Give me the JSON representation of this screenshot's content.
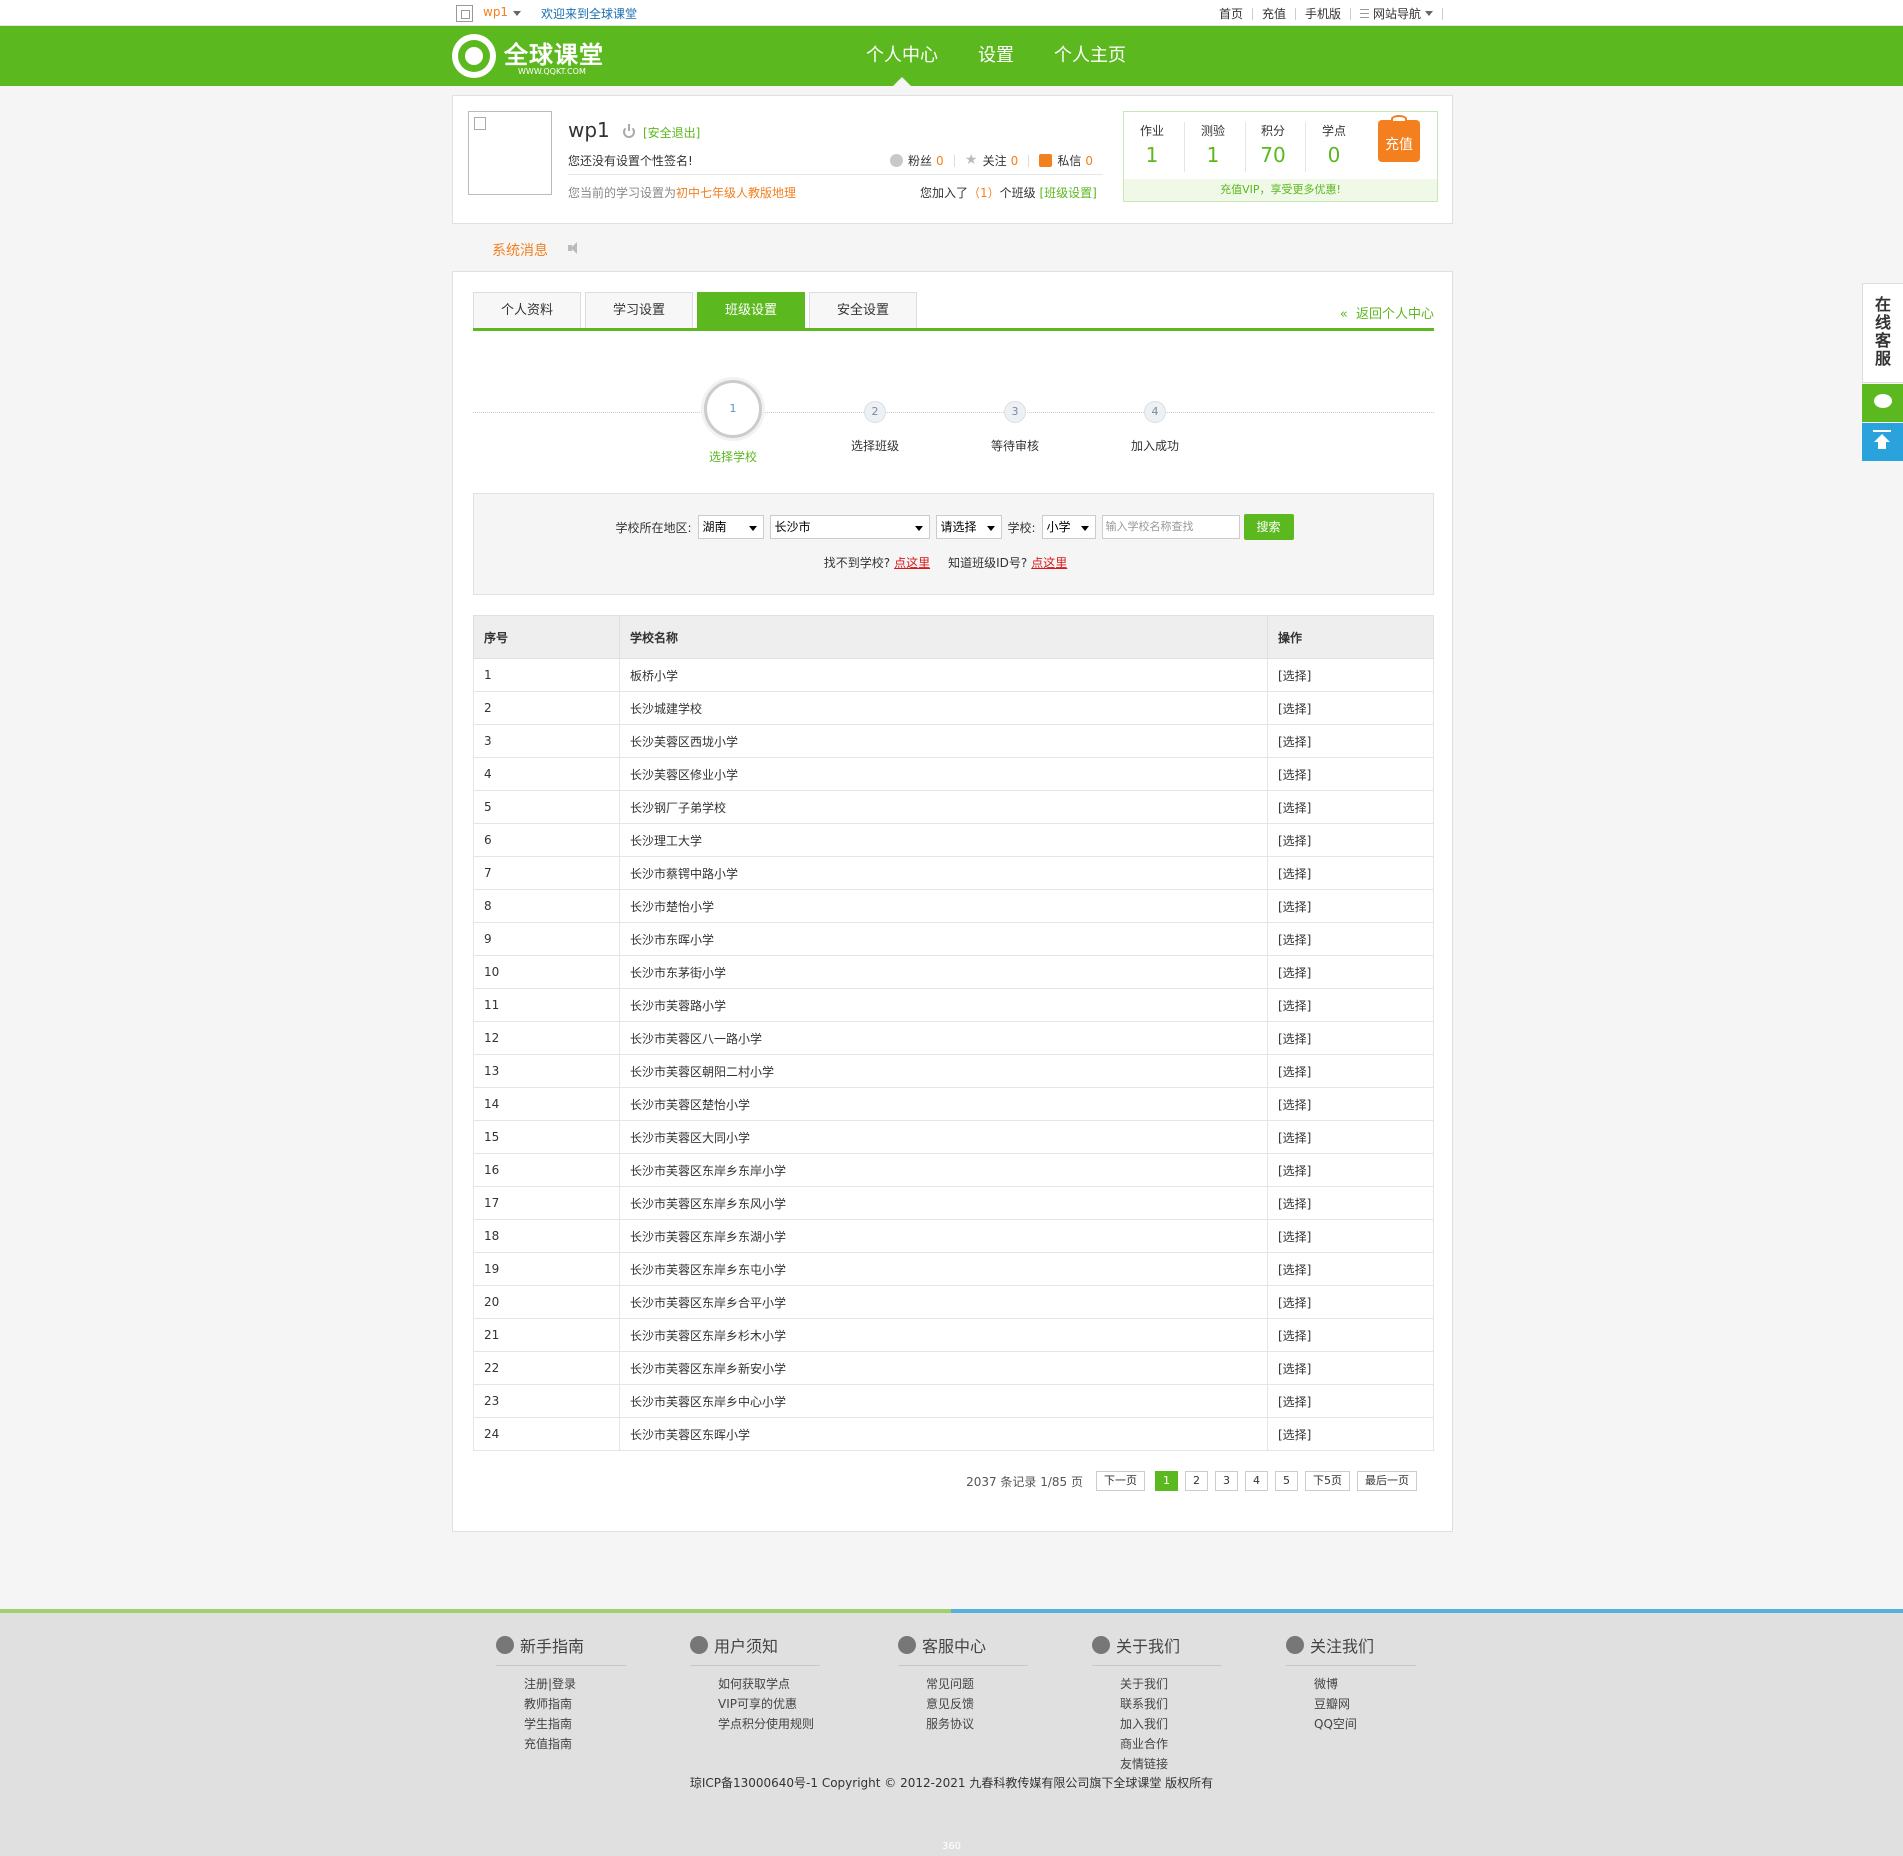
{
  "topbar": {
    "user": "wp1",
    "welcome": "欢迎来到全球课堂",
    "links": [
      "首页",
      "充值",
      "手机版",
      "网站导航"
    ]
  },
  "header": {
    "logo_text": "全球课堂",
    "logo_sub": "WWW.QQKT.COM",
    "nav": [
      "个人中心",
      "设置",
      "个人主页"
    ]
  },
  "profile": {
    "name": "wp1",
    "logout": "[安全退出]",
    "signature": "您还没有设置个性签名!",
    "fans_label": "粉丝",
    "fans": "0",
    "follow_label": "关注",
    "follow": "0",
    "msg_label": "私信",
    "msg": "0",
    "study_prefix": "您当前的学习设置为",
    "study_grade": "初中七年级人教版地理",
    "joined_prefix": "您加入了",
    "joined_count": "（1）",
    "joined_suffix": "个班级",
    "class_settings": "[班级设置]"
  },
  "stats": {
    "items": [
      {
        "label": "作业",
        "value": "1"
      },
      {
        "label": "测验",
        "value": "1"
      },
      {
        "label": "积分",
        "value": "70"
      },
      {
        "label": "学点",
        "value": "0"
      }
    ],
    "recharge": "充值",
    "vip": "充值VIP，享受更多优惠!"
  },
  "system_message": "系统消息",
  "tabs": [
    "个人资料",
    "学习设置",
    "班级设置",
    "安全设置"
  ],
  "back_link": "返回个人中心",
  "steps": [
    {
      "num": "1",
      "label": "选择学校"
    },
    {
      "num": "2",
      "label": "选择班级"
    },
    {
      "num": "3",
      "label": "等待审核"
    },
    {
      "num": "4",
      "label": "加入成功"
    }
  ],
  "search": {
    "region_label": "学校所在地区:",
    "province": "湖南",
    "city": "长沙市",
    "district": "请选择",
    "school_label": "学校:",
    "level": "小学",
    "placeholder": "输入学校名称查找",
    "button": "搜索",
    "not_found": "找不到学校?",
    "click_here": "点这里",
    "know_id": "知道班级ID号?",
    "click_here2": "点这里"
  },
  "table": {
    "headers": [
      "序号",
      "学校名称",
      "操作"
    ],
    "rows": [
      [
        "1",
        "板桥小学",
        "[选择]"
      ],
      [
        "2",
        "长沙城建学校",
        "[选择]"
      ],
      [
        "3",
        "长沙芙蓉区西垅小学",
        "[选择]"
      ],
      [
        "4",
        "长沙芙蓉区修业小学",
        "[选择]"
      ],
      [
        "5",
        "长沙钢厂子弟学校",
        "[选择]"
      ],
      [
        "6",
        "长沙理工大学",
        "[选择]"
      ],
      [
        "7",
        "长沙市蔡锷中路小学",
        "[选择]"
      ],
      [
        "8",
        "长沙市楚怡小学",
        "[选择]"
      ],
      [
        "9",
        "长沙市东晖小学",
        "[选择]"
      ],
      [
        "10",
        "长沙市东茅街小学",
        "[选择]"
      ],
      [
        "11",
        "长沙市芙蓉路小学",
        "[选择]"
      ],
      [
        "12",
        "长沙市芙蓉区八一路小学",
        "[选择]"
      ],
      [
        "13",
        "长沙市芙蓉区朝阳二村小学",
        "[选择]"
      ],
      [
        "14",
        "长沙市芙蓉区楚怡小学",
        "[选择]"
      ],
      [
        "15",
        "长沙市芙蓉区大同小学",
        "[选择]"
      ],
      [
        "16",
        "长沙市芙蓉区东岸乡东岸小学",
        "[选择]"
      ],
      [
        "17",
        "长沙市芙蓉区东岸乡东风小学",
        "[选择]"
      ],
      [
        "18",
        "长沙市芙蓉区东岸乡东湖小学",
        "[选择]"
      ],
      [
        "19",
        "长沙市芙蓉区东岸乡东屯小学",
        "[选择]"
      ],
      [
        "20",
        "长沙市芙蓉区东岸乡合平小学",
        "[选择]"
      ],
      [
        "21",
        "长沙市芙蓉区东岸乡杉木小学",
        "[选择]"
      ],
      [
        "22",
        "长沙市芙蓉区东岸乡新安小学",
        "[选择]"
      ],
      [
        "23",
        "长沙市芙蓉区东岸乡中心小学",
        "[选择]"
      ],
      [
        "24",
        "长沙市芙蓉区东晖小学",
        "[选择]"
      ]
    ]
  },
  "pager": {
    "records": "2037 条记录 1/85 页",
    "prev": "下一页",
    "pages": [
      "1",
      "2",
      "3",
      "4",
      "5"
    ],
    "next5": "下5页",
    "last": "最后一页"
  },
  "float": {
    "service": "在线客服"
  },
  "footer": {
    "columns": [
      {
        "title": "新手指南",
        "links": [
          "注册|登录",
          "教师指南",
          "学生指南",
          "充值指南"
        ]
      },
      {
        "title": "用户须知",
        "links": [
          "如何获取学点",
          "VIP可享的优惠",
          "学点积分使用规则"
        ]
      },
      {
        "title": "客服中心",
        "links": [
          "常见问题",
          "意见反馈",
          "服务协议"
        ]
      },
      {
        "title": "关于我们",
        "links": [
          "关于我们",
          "联系我们",
          "加入我们",
          "商业合作",
          "友情链接"
        ]
      },
      {
        "title": "关注我们",
        "links": [
          "微博",
          "豆瓣网",
          "QQ空间"
        ]
      }
    ],
    "copyright": "琼ICP备13000640号-1 Copyright © 2012-2021 九春科教传媒有限公司旗下全球课堂 版权所有",
    "bottom": "360"
  },
  "colors": {
    "brand_green": "#5cb81f",
    "accent_orange": "#f47f1f",
    "link_blue": "#1a6fb0",
    "alert_red": "#d6191c"
  }
}
